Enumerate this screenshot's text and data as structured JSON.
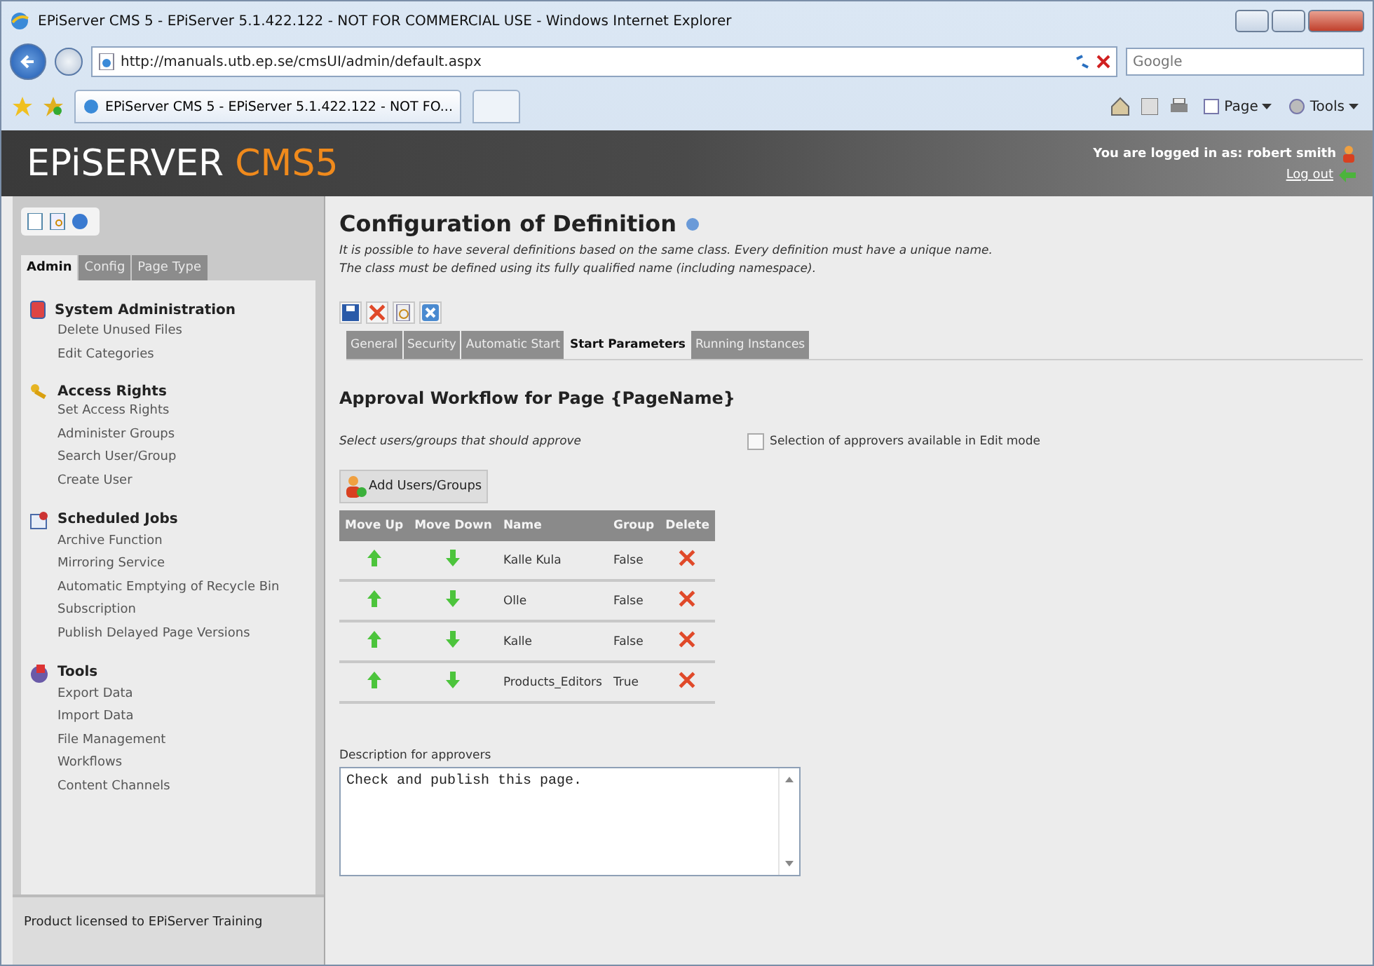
{
  "window": {
    "title": "EPiServer CMS 5 - EPiServer 5.1.422.122 - NOT FOR COMMERCIAL USE - Windows Internet Explorer"
  },
  "address_bar": {
    "url": "http://manuals.utb.ep.se/cmsUI/admin/default.aspx",
    "search_placeholder": "Google"
  },
  "browser_tab": {
    "title": "EPiServer CMS 5 - EPiServer 5.1.422.122 - NOT FO..."
  },
  "command_bar": [
    "Page",
    "Tools"
  ],
  "header": {
    "logo": "EPiSERVER",
    "logo_accent": "CMS5",
    "logged_in_label": "You are logged in as:",
    "user": "robert smith",
    "logout": "Log out"
  },
  "sidebar": {
    "tabs": [
      {
        "label": "Admin",
        "selected": true
      },
      {
        "label": "Config",
        "selected": false
      },
      {
        "label": "Page Type",
        "selected": false
      }
    ],
    "sections": [
      {
        "kind": "system",
        "title": "System Administration",
        "items": [
          "Delete Unused Files",
          "Edit Categories"
        ]
      },
      {
        "kind": "access",
        "title": "Access Rights",
        "items": [
          "Set Access Rights",
          "Administer Groups",
          "Search User/Group",
          "Create User"
        ]
      },
      {
        "kind": "jobs",
        "title": "Scheduled Jobs",
        "items": [
          "Archive Function",
          "Mirroring Service",
          "Automatic Emptying of Recycle Bin",
          "Subscription",
          "Publish Delayed Page Versions"
        ]
      },
      {
        "kind": "tools",
        "title": "Tools",
        "items": [
          "Export Data",
          "Import Data",
          "File Management",
          "Workflows",
          "Content Channels"
        ]
      }
    ],
    "footer": "Product licensed to EPiServer Training"
  },
  "main": {
    "title": "Configuration of Definition",
    "description": [
      "It is possible to have several definitions based on the same class. Every definition must have a unique name.",
      "The class must be defined using its fully qualified name (including namespace)."
    ],
    "toolbar": [
      {
        "kind": "save"
      },
      {
        "kind": "delete"
      },
      {
        "kind": "preview"
      },
      {
        "kind": "close"
      }
    ],
    "tabs": [
      {
        "label": "General",
        "selected": false
      },
      {
        "label": "Security",
        "selected": false
      },
      {
        "label": "Automatic Start",
        "selected": false
      },
      {
        "label": "Start Parameters",
        "selected": true
      },
      {
        "label": "Running Instances",
        "selected": false
      }
    ],
    "heading": "Approval Workflow for Page {PageName}",
    "instruction": "Select users/groups that should approve",
    "edit_mode_checkbox": {
      "label": "Selection of approvers available in Edit mode",
      "checked": false
    },
    "add_button": "Add Users/Groups",
    "table": {
      "columns": [
        "Move Up",
        "Move Down",
        "Name",
        "Group",
        "Delete"
      ],
      "rows": [
        {
          "name": "Kalle Kula",
          "group": "False"
        },
        {
          "name": "Olle",
          "group": "False"
        },
        {
          "name": "Kalle",
          "group": "False"
        },
        {
          "name": "Products_Editors",
          "group": "True"
        }
      ]
    },
    "description_label": "Description for approvers",
    "description_value": "Check and publish this page."
  }
}
